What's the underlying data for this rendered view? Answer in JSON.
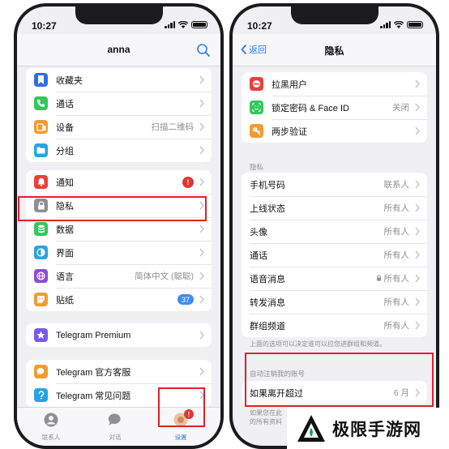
{
  "left_phone": {
    "status_time": "10:27",
    "nav_title": "anna",
    "group1": [
      {
        "label": "收藏夹",
        "icon": "bookmark-icon",
        "color": "#2f6ee8",
        "value": ""
      },
      {
        "label": "通话",
        "icon": "phone-icon",
        "color": "#34c759",
        "value": ""
      },
      {
        "label": "设备",
        "icon": "devices-icon",
        "color": "#f29b30",
        "value": "扫描二维码"
      },
      {
        "label": "分组",
        "icon": "folder-icon",
        "color": "#2aa3e0",
        "value": ""
      }
    ],
    "group2": [
      {
        "label": "通知",
        "icon": "bell-icon",
        "color": "#e8413a",
        "badge": "!"
      },
      {
        "label": "隐私",
        "icon": "lock-icon",
        "color": "#8e8e93"
      },
      {
        "label": "数据",
        "icon": "database-icon",
        "color": "#34c759"
      },
      {
        "label": "界面",
        "icon": "appearance-icon",
        "color": "#2aa3e0"
      },
      {
        "label": "语言",
        "icon": "globe-icon",
        "color": "#8d4bd6",
        "value": "简体中文 (聪聪)"
      },
      {
        "label": "贴纸",
        "icon": "sticker-icon",
        "color": "#f29b30",
        "badge": "37"
      }
    ],
    "premium": {
      "label": "Telegram Premium",
      "icon": "star-icon",
      "color": "#7b58e8"
    },
    "help": [
      {
        "label": "Telegram 官方客服",
        "icon": "chat-icon",
        "color": "#f29b30"
      },
      {
        "label": "Telegram 常见问题",
        "icon": "question-icon",
        "color": "#2aa3e0"
      }
    ],
    "tabs": [
      {
        "label": "联系人"
      },
      {
        "label": "对话"
      },
      {
        "label": "设置",
        "badge": "!"
      }
    ]
  },
  "right_phone": {
    "status_time": "10:27",
    "back_label": "返回",
    "nav_title": "隐私",
    "group1": [
      {
        "label": "拉黑用户",
        "icon": "blocked-icon",
        "color": "#e8413a",
        "value": ""
      },
      {
        "label": "锁定密码 & Face ID",
        "icon": "faceid-icon",
        "color": "#34c759",
        "value": "关闭"
      },
      {
        "label": "两步验证",
        "icon": "key-icon",
        "color": "#f29b30",
        "value": ""
      }
    ],
    "privacy_header": "隐私",
    "privacy_rows": [
      {
        "label": "手机号码",
        "value": "联系人"
      },
      {
        "label": "上线状态",
        "value": "所有人"
      },
      {
        "label": "头像",
        "value": "所有人"
      },
      {
        "label": "通话",
        "value": "所有人"
      },
      {
        "label": "语音消息",
        "value": "所有人",
        "locked": true
      },
      {
        "label": "转发消息",
        "value": "所有人"
      },
      {
        "label": "群组频道",
        "value": "所有人"
      }
    ],
    "privacy_note": "上面的选项可以决定谁可以拉您进群组和频道。",
    "auto_delete_header": "自动注销我的账号",
    "auto_delete_row": {
      "label": "如果离开超过",
      "value": "6 月"
    },
    "auto_delete_note_1": "如果您在此",
    "auto_delete_note_2": "的所有资料"
  },
  "watermark": {
    "text": "极限手游网"
  },
  "colors": {
    "accent": "#2f7cf6",
    "highlight": "#e0212b",
    "background": "#efeff4"
  }
}
